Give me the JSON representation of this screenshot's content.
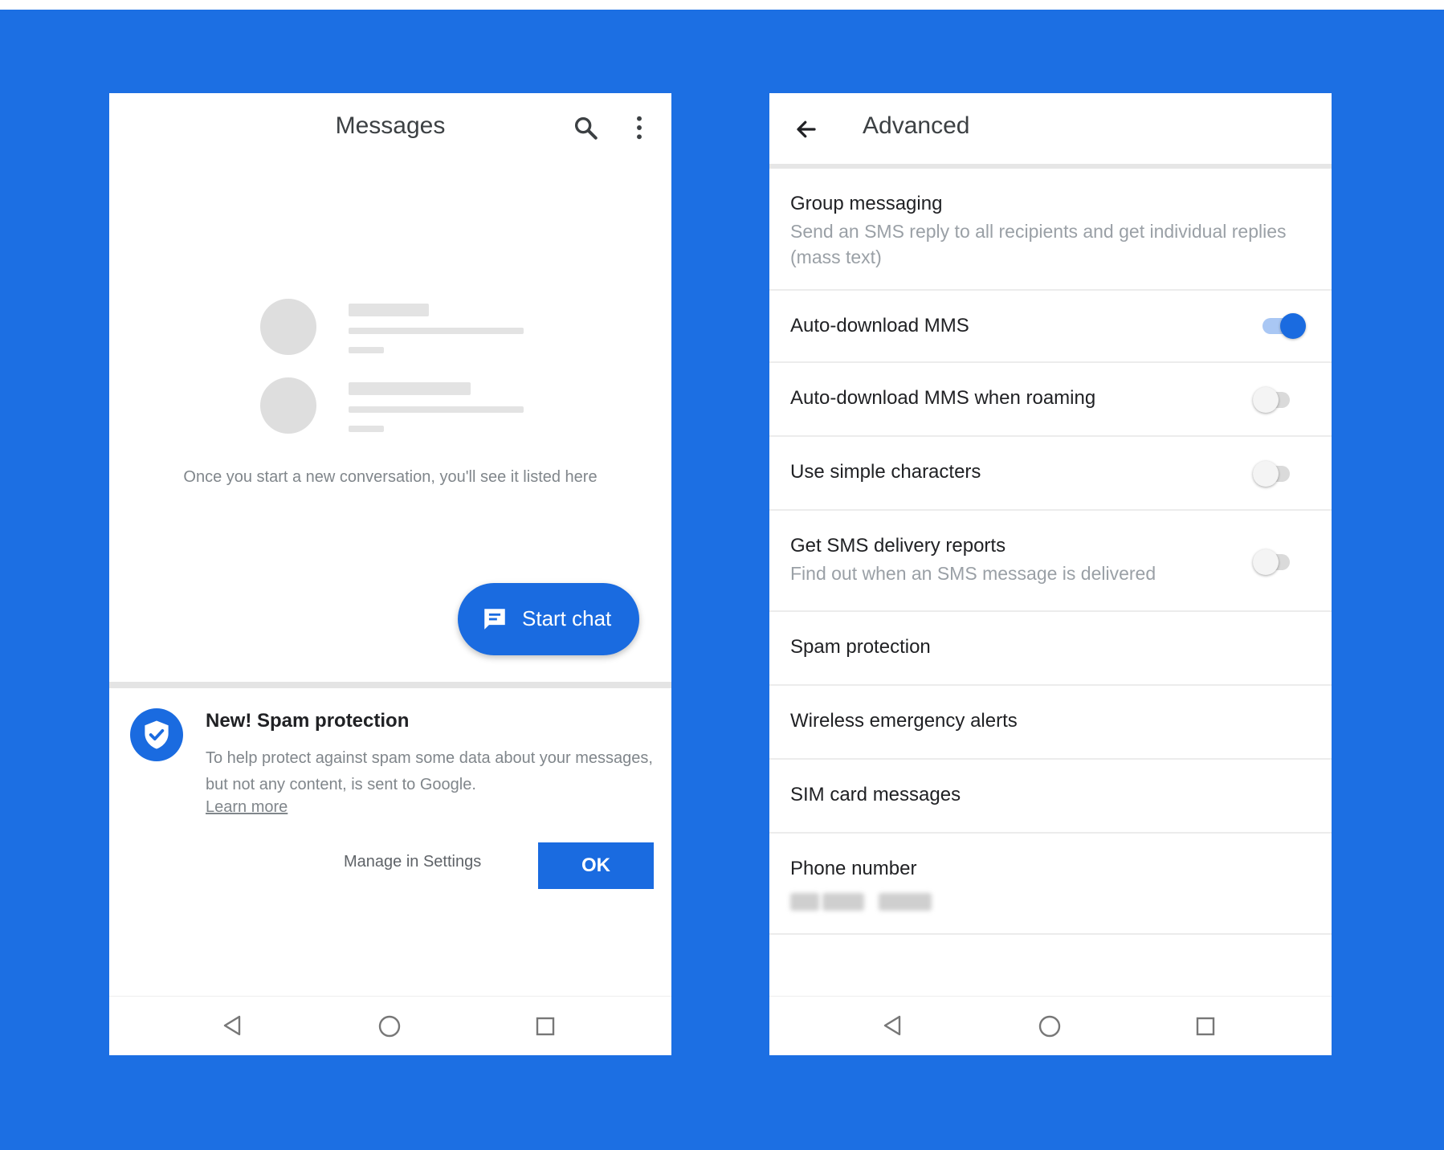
{
  "colors": {
    "background": "#1c6fe3",
    "accent": "#1a6be0",
    "primary_text": "#202124",
    "secondary_text": "#80868b"
  },
  "left_phone": {
    "header": {
      "title": "Messages",
      "search_icon": "search-icon",
      "more_icon": "more-vert-icon"
    },
    "empty_state": {
      "message": "Once you start a new conversation, you'll see it listed here"
    },
    "fab": {
      "label": "Start chat",
      "icon": "chat-icon"
    },
    "spam_card": {
      "icon": "shield-check-icon",
      "title": "New! Spam protection",
      "description": "To help protect against spam some data about your messages, but not any content, is sent to Google.",
      "learn_more": "Learn more",
      "secondary_action": "Manage in Settings",
      "primary_action": "OK"
    },
    "navbar": [
      "back-triangle-icon",
      "home-circle-icon",
      "recents-square-icon"
    ]
  },
  "right_phone": {
    "header": {
      "title": "Advanced",
      "back_icon": "back-arrow-icon"
    },
    "settings": [
      {
        "title": "Group messaging",
        "subtitle": "Send an SMS reply to all recipients and get individual replies (mass text)"
      },
      {
        "title": "Auto-download MMS",
        "toggle": true
      },
      {
        "title": "Auto-download MMS when roaming",
        "toggle": false
      },
      {
        "title": "Use simple characters",
        "toggle": false
      },
      {
        "title": "Get SMS delivery reports",
        "subtitle": "Find out when an SMS message is delivered",
        "toggle": false
      },
      {
        "title": "Spam protection"
      },
      {
        "title": "Wireless emergency alerts"
      },
      {
        "title": "SIM card messages"
      },
      {
        "title": "Phone number",
        "subtitle_redacted": true
      }
    ],
    "navbar": [
      "back-triangle-icon",
      "home-circle-icon",
      "recents-square-icon"
    ]
  }
}
